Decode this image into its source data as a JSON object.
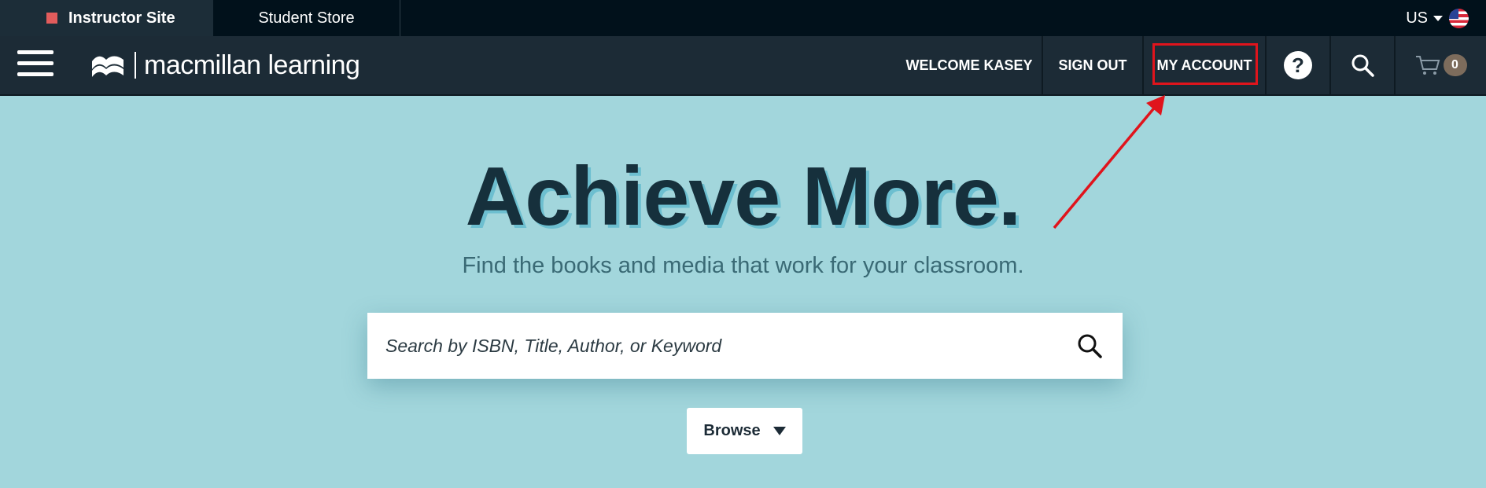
{
  "topbar": {
    "tabs": [
      {
        "label": "Instructor Site",
        "active": true,
        "marker_color": "#e25c5c"
      },
      {
        "label": "Student Store",
        "active": false
      }
    ],
    "locale": {
      "label": "US",
      "flag": "us-flag-icon"
    }
  },
  "header": {
    "menu_icon": "hamburger-icon",
    "logo": {
      "icon": "macmillan-logo-icon",
      "text": "macmillan learning"
    },
    "nav": {
      "welcome": "WELCOME KASEY",
      "sign_out": "SIGN OUT",
      "my_account": "MY ACCOUNT",
      "help_icon": "question-mark-icon",
      "help_glyph": "?",
      "search_icon": "search-icon",
      "cart_icon": "cart-icon",
      "cart_count": "0"
    }
  },
  "hero": {
    "title": "Achieve More.",
    "subtitle": "Find the books and media that work for your classroom."
  },
  "search": {
    "placeholder": "Search by ISBN, Title, Author, or Keyword",
    "value": "",
    "button_icon": "search-icon"
  },
  "browse": {
    "label": "Browse",
    "icon": "caret-down-icon"
  },
  "annotation": {
    "highlight_color": "#e0141c",
    "target": "MY ACCOUNT"
  },
  "colors": {
    "topbar_bg": "#01111b",
    "nav_bg": "#1c2b36",
    "hero_bg": "#a2d6dc",
    "title_color": "#16303c",
    "accent_red": "#e0141c"
  }
}
